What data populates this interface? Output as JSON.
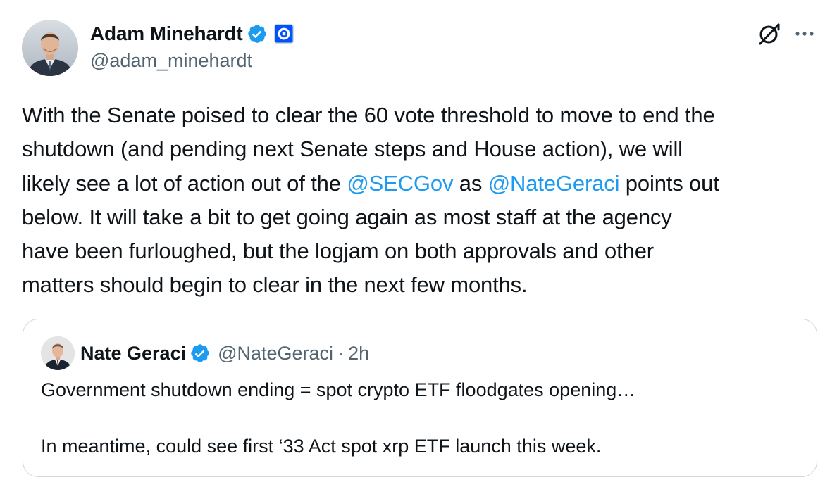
{
  "author": {
    "display_name": "Adam Minehardt",
    "handle": "@adam_minehardt",
    "verified_icon": "verified-badge-icon",
    "affiliation_icon": "coinbase-affiliation-icon"
  },
  "actions": {
    "grok_icon": "grok-icon",
    "more_icon": "more-options-icon"
  },
  "tweet": {
    "lines": [
      {
        "parts": [
          {
            "text": "With the Senate poised to clear the 60 vote threshold to move to end the"
          }
        ]
      },
      {
        "parts": [
          {
            "text": "shutdown (and pending next Senate steps and House action), we will"
          }
        ]
      },
      {
        "parts": [
          {
            "text": "likely see a lot of action out of the "
          },
          {
            "text": "@SECGov",
            "mention": true
          },
          {
            "text": " as "
          },
          {
            "text": "@NateGeraci",
            "mention": true
          },
          {
            "text": " points out"
          }
        ]
      },
      {
        "parts": [
          {
            "text": "below. It will take a bit to get going again as most staff at the agency"
          }
        ]
      },
      {
        "parts": [
          {
            "text": "have been furloughed, but the logjam on both approvals and other"
          }
        ]
      },
      {
        "parts": [
          {
            "text": "matters should begin to clear in the next few months."
          }
        ]
      }
    ]
  },
  "quoted_tweet": {
    "display_name": "Nate Geraci",
    "handle": "@NateGeraci",
    "separator": "·",
    "time": "2h",
    "lines": [
      "Government shutdown ending = spot crypto ETF floodgates opening…",
      "",
      "In meantime, could see first ‘33 Act spot xrp ETF launch this week."
    ]
  },
  "colors": {
    "link": "#1d9bf0",
    "secondary_text": "#536471",
    "primary_text": "#0f1419",
    "border": "#cfd9de",
    "affiliation_blue": "#0052ff"
  }
}
